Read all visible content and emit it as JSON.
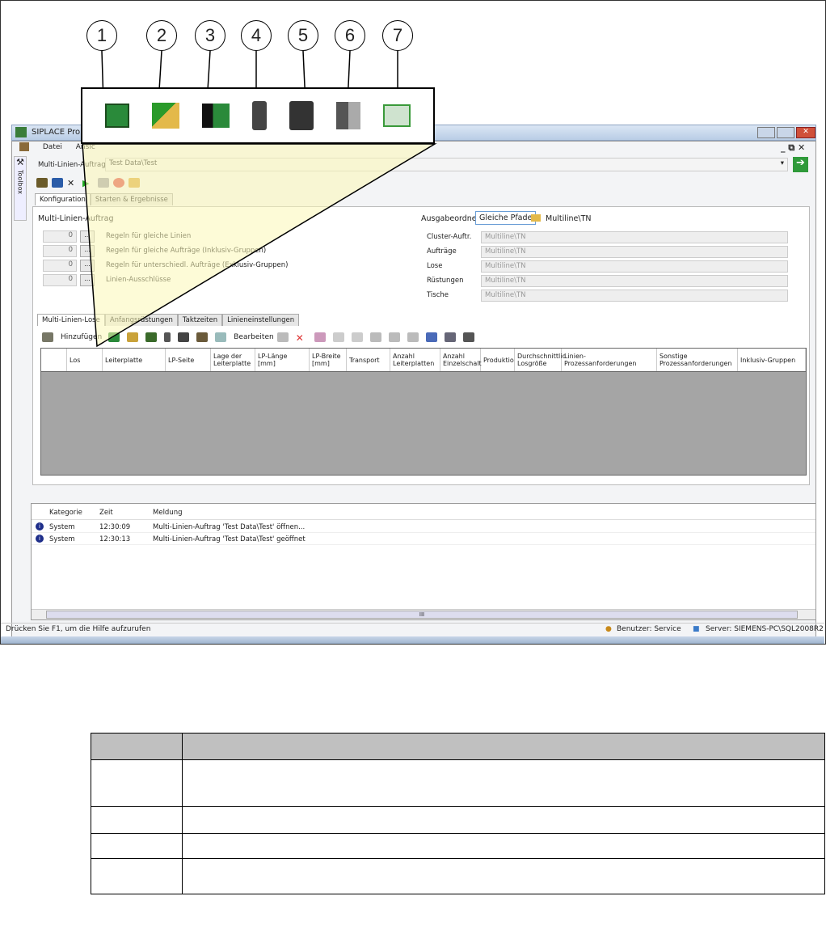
{
  "callout": {
    "numbers": [
      "1",
      "2",
      "3",
      "4",
      "5",
      "6",
      "7"
    ],
    "icons": [
      "pcb-icon",
      "setup-change-icon",
      "pcb-transfer-icon",
      "traffic-light-icon",
      "traffic-lights-multi-icon",
      "traffic-light-microscope-icon",
      "table-import-icon"
    ]
  },
  "window": {
    "title": "SIPLACE Pro Op",
    "menu": [
      "Datei",
      "Ansic"
    ],
    "toolbox_label": "Toolbox"
  },
  "job": {
    "label": "Multi-Linien-Auftrag",
    "value": "Test Data\\Test"
  },
  "tabs": [
    "Konfiguration",
    "Starten & Ergebnisse"
  ],
  "config": {
    "section_title": "Multi-Linien-Auftrag",
    "rules": [
      {
        "count": "0",
        "btn": "...",
        "label": "Regeln für gleiche Linien"
      },
      {
        "count": "0",
        "btn": "...",
        "label": "Regeln für gleiche Aufträge (Inklusiv-Gruppen)"
      },
      {
        "count": "0",
        "btn": "...",
        "label": "Regeln für unterschiedl. Aufträge (Exklusiv-Gruppen)"
      },
      {
        "count": "0",
        "btn": "...",
        "label": "Linien-Ausschlüsse"
      }
    ],
    "output_label": "Ausgabeordner",
    "same_paths": "Gleiche Pfade",
    "output_path": "Multiline\\TN",
    "paths": [
      {
        "label": "Cluster-Auftr.",
        "value": "Multiline\\TN"
      },
      {
        "label": "Aufträge",
        "value": "Multiline\\TN"
      },
      {
        "label": "Lose",
        "value": "Multiline\\TN"
      },
      {
        "label": "Rüstungen",
        "value": "Multiline\\TN"
      },
      {
        "label": "Tische",
        "value": "Multiline\\TN"
      }
    ]
  },
  "subtabs": [
    "Multi-Linien-Lose",
    "Anfangsrüstungen",
    "Taktzeiten",
    "Linieneinstellungen"
  ],
  "grid_toolbar": {
    "add": "Hinzufügen",
    "edit": "Bearbeiten"
  },
  "grid_columns": [
    "Los",
    "Leiterplatte",
    "LP-Seite",
    "Lage der Leiterplatte",
    "LP-Länge [mm]",
    "LP-Breite [mm]",
    "Transport",
    "Anzahl Leiterplatten",
    "Anzahl Einzelschalt",
    "Produktio",
    "Durchschnittlic Losgröße",
    "Linien-Prozessanforderungen",
    "Sonstige Prozessanforderungen",
    "Inklusiv-Gruppen"
  ],
  "log": {
    "columns": [
      "Kategorie",
      "Zeit",
      "Meldung"
    ],
    "rows": [
      {
        "cat": "System",
        "time": "12:30:09",
        "msg": "Multi-Linien-Auftrag 'Test Data\\Test' öffnen..."
      },
      {
        "cat": "System",
        "time": "12:30:13",
        "msg": "Multi-Linien-Auftrag 'Test Data\\Test' geöffnet"
      }
    ],
    "scroll_grip": "III"
  },
  "status": {
    "help": "Drücken Sie F1, um die Hilfe aufzurufen",
    "user": "Benutzer: Service",
    "server": "Server: SIEMENS-PC\\SQL2008R2"
  },
  "colors": {
    "highlight": "#fbf7b6",
    "grid_bg": "#a5a5a5",
    "table_header": "#c0c0c0"
  }
}
